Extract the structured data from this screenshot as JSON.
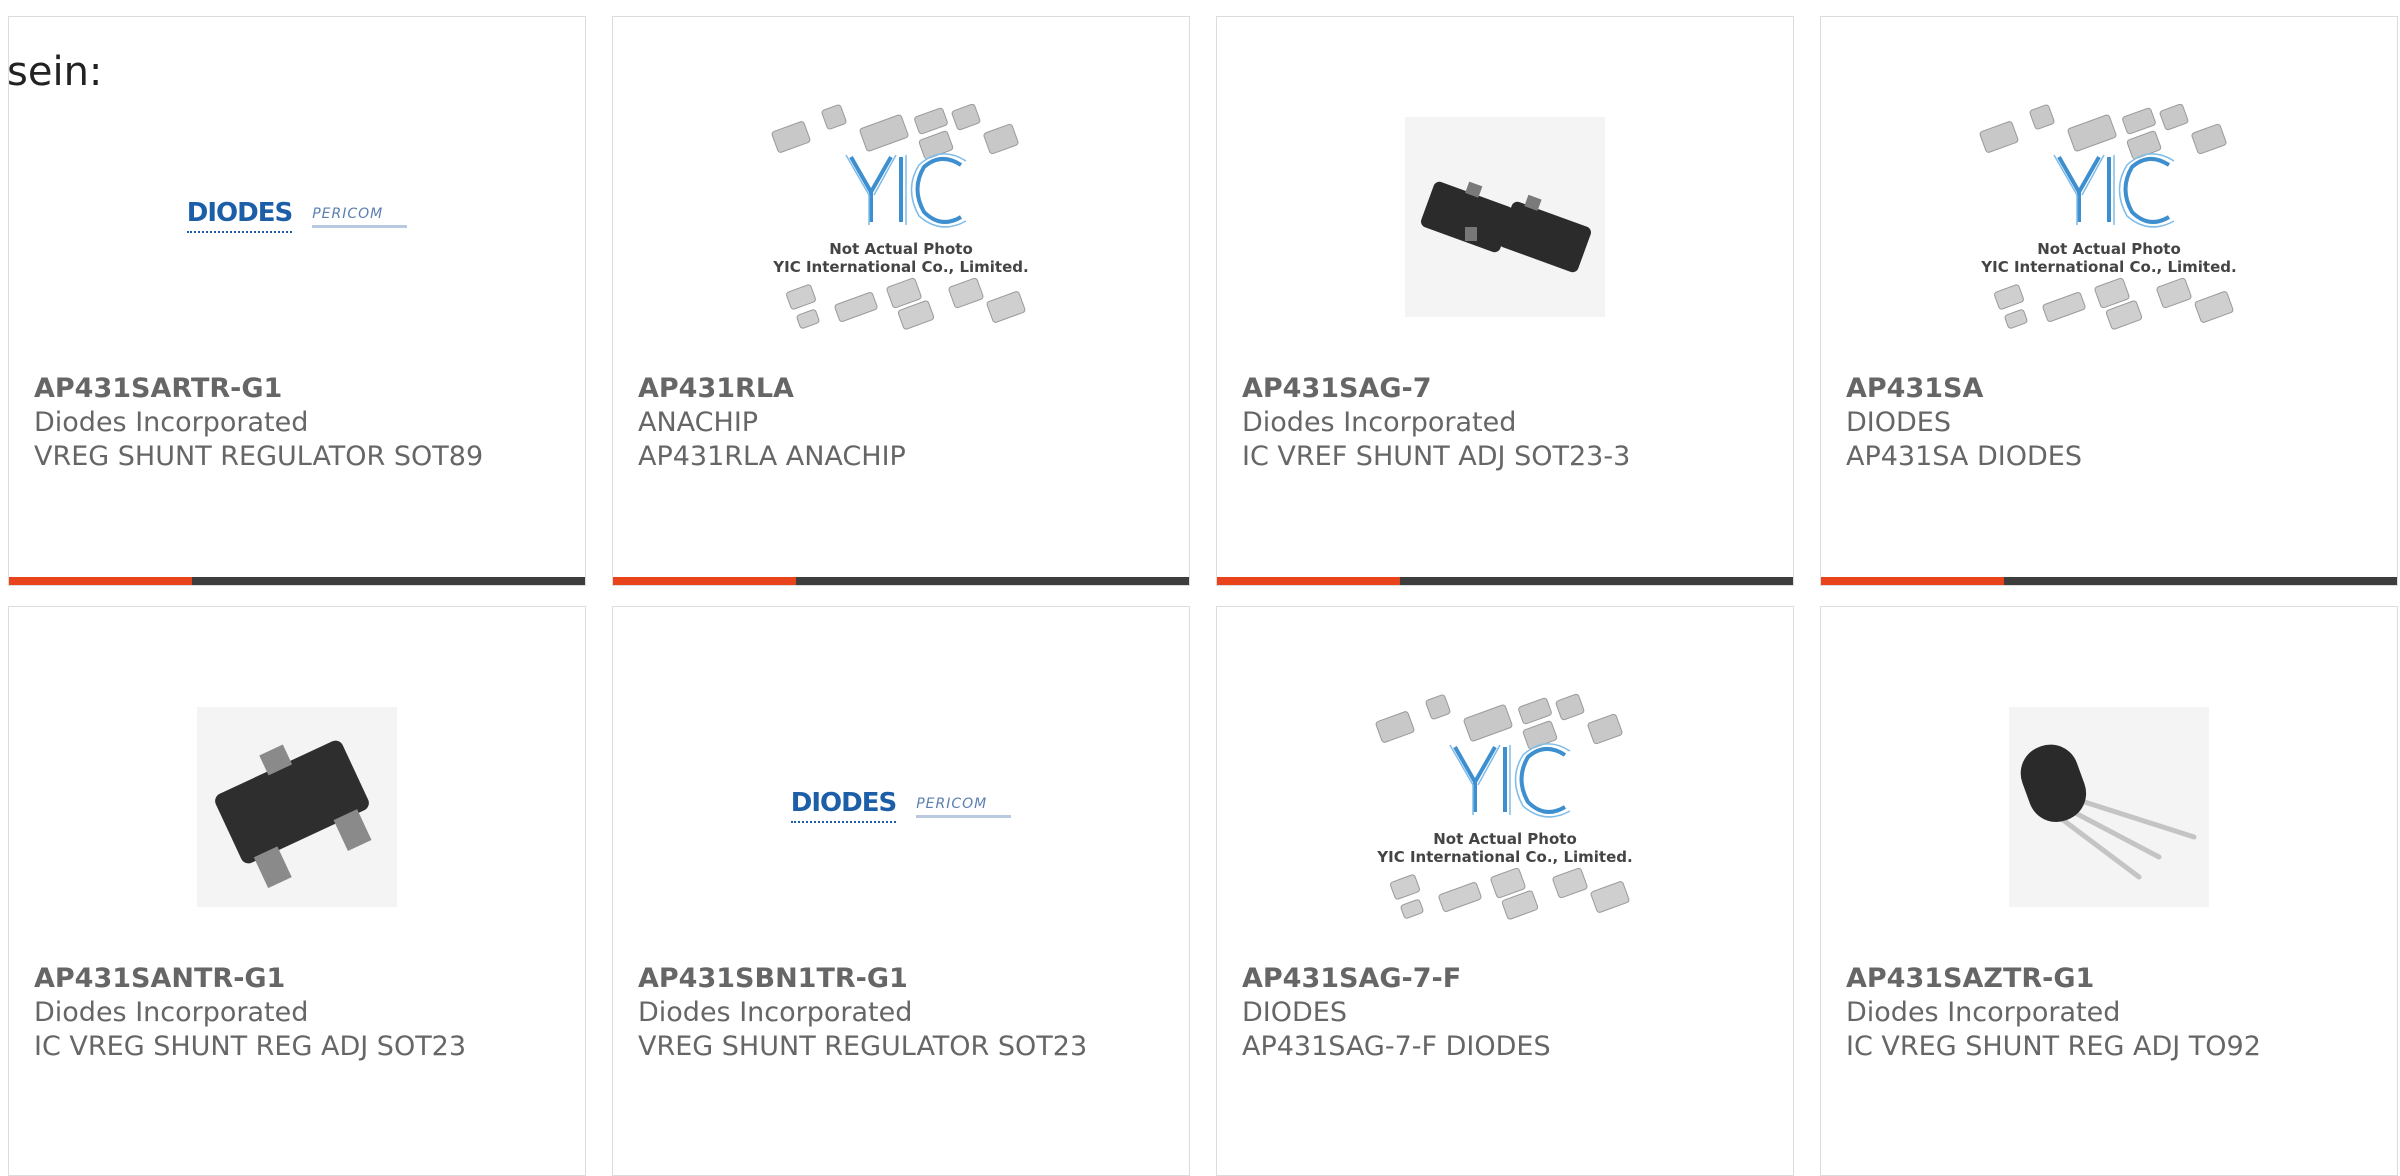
{
  "intro_text": "sein:",
  "colors": {
    "accent": "#e8431b",
    "bar": "#3d3d3d",
    "text": "#666666",
    "border": "#dcdcdc"
  },
  "placeholder": {
    "line1": "Not Actual Photo",
    "line2": "YIC International Co., Limited.",
    "logo_letters": "YIC"
  },
  "diodes_logo": {
    "brand": "DIODES",
    "sub": "PERICOM"
  },
  "products": [
    {
      "part": "AP431SARTR-G1",
      "manufacturer": "Diodes Incorporated",
      "description": "VREG SHUNT REGULATOR SOT89",
      "image": "diodes-logo"
    },
    {
      "part": "AP431RLA",
      "manufacturer": "ANACHIP",
      "description": "AP431RLA ANACHIP",
      "image": "yic-placeholder"
    },
    {
      "part": "AP431SAG-7",
      "manufacturer": "Diodes Incorporated",
      "description": "IC VREF SHUNT ADJ SOT23-3",
      "image": "sot23-photo"
    },
    {
      "part": "AP431SA",
      "manufacturer": "DIODES",
      "description": "AP431SA DIODES",
      "image": "yic-placeholder"
    },
    {
      "part": "AP431SANTR-G1",
      "manufacturer": "Diodes Incorporated",
      "description": "IC VREG SHUNT REG ADJ SOT23",
      "image": "sot23-photo-large"
    },
    {
      "part": "AP431SBN1TR-G1",
      "manufacturer": "Diodes Incorporated",
      "description": "VREG SHUNT REGULATOR SOT23",
      "image": "diodes-logo"
    },
    {
      "part": "AP431SAG-7-F",
      "manufacturer": "DIODES",
      "description": "AP431SAG-7-F DIODES",
      "image": "yic-placeholder"
    },
    {
      "part": "AP431SAZTR-G1",
      "manufacturer": "Diodes Incorporated",
      "description": "IC VREG SHUNT REG ADJ TO92",
      "image": "to92-photo"
    }
  ]
}
